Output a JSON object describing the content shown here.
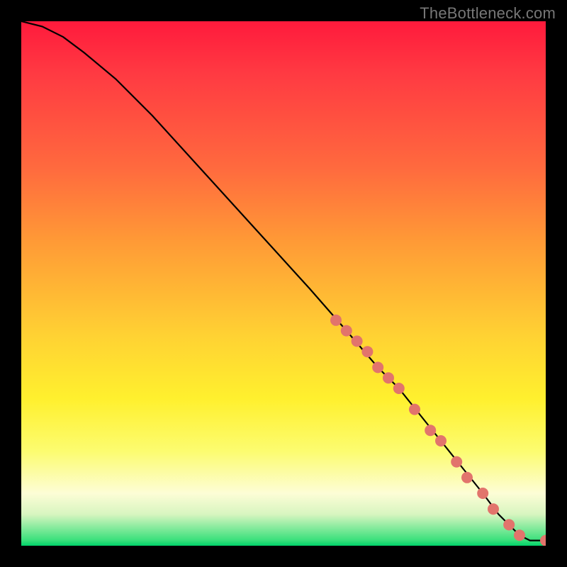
{
  "watermark": "TheBottleneck.com",
  "chart_data": {
    "type": "line",
    "title": "",
    "xlabel": "",
    "ylabel": "",
    "xlim": [
      0,
      100
    ],
    "ylim": [
      0,
      100
    ],
    "grid": false,
    "legend": false,
    "gradient_colors": {
      "top": "#ff1a3c",
      "mid": "#ffd233",
      "bottom": "#00d26a"
    },
    "series": [
      {
        "name": "bottleneck-curve",
        "type": "line",
        "x": [
          0,
          4,
          8,
          12,
          18,
          25,
          35,
          45,
          55,
          62,
          68,
          72,
          76,
          80,
          84,
          88,
          91,
          93,
          95,
          97,
          100
        ],
        "y": [
          100,
          99,
          97,
          94,
          89,
          82,
          71,
          60,
          49,
          41,
          34,
          30,
          25,
          20,
          15,
          10,
          6,
          4,
          2,
          1,
          1
        ]
      },
      {
        "name": "highlighted-points",
        "type": "scatter",
        "x": [
          60,
          62,
          64,
          66,
          68,
          70,
          72,
          75,
          78,
          80,
          83,
          85,
          88,
          90,
          93,
          95,
          100
        ],
        "y": [
          43,
          41,
          39,
          37,
          34,
          32,
          30,
          26,
          22,
          20,
          16,
          13,
          10,
          7,
          4,
          2,
          1
        ]
      }
    ]
  }
}
